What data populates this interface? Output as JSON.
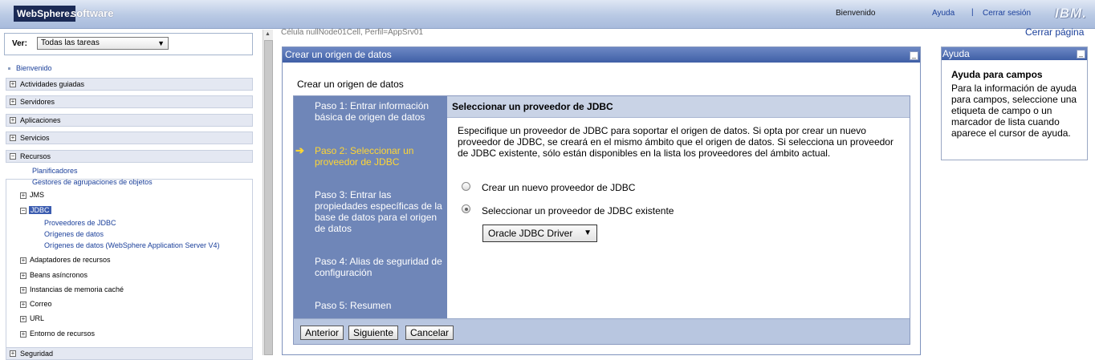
{
  "header": {
    "brand": "WebSphere.",
    "brand_suffix": "software",
    "welcome": "Bienvenido",
    "help": "Ayuda",
    "separator": "|",
    "logout": "Cerrar sesión",
    "vendor_logo": "IBM."
  },
  "sidebar": {
    "view_label": "Ver:",
    "view_value": "Todas las tareas",
    "welcome_link": "Bienvenido",
    "categories": [
      "Actividades guiadas",
      "Servidores",
      "Aplicaciones",
      "Servicios",
      "Recursos",
      "Seguridad"
    ],
    "recursos": {
      "schedulers": "Planificadores",
      "pool_managers": "Gestores de agrupaciones de objetos",
      "jms": "JMS",
      "jdbc": "JDBC",
      "jdbc_providers": "Proveedores de JDBC",
      "data_sources": "Orígenes de datos",
      "data_sources_v4": "Orígenes de datos (WebSphere Application Server V4)",
      "resource_adapters": "Adaptadores de recursos",
      "async_beans": "Beans asíncronos",
      "cache_instances": "Instancias de memoria caché",
      "mail": "Correo",
      "url": "URL",
      "resource_env": "Entorno de recursos"
    }
  },
  "main": {
    "breadcrumb": "Célula nullNode01Cell, Perfil=AppSrv01",
    "close_page": "Cerrar página",
    "panel_title": "Crear un origen de datos",
    "wizard_heading": "Crear un origen de datos",
    "steps": [
      "Paso 1: Entrar información básica de origen de datos",
      "Paso 2: Seleccionar un proveedor de JDBC",
      "Paso 3: Entrar las propiedades específicas de la base de datos para el origen de datos",
      "Paso 4: Alias de seguridad de configuración",
      "Paso 5: Resumen"
    ],
    "active_step": 2,
    "content_title": "Seleccionar un proveedor de JDBC",
    "description": "Especifique un proveedor de JDBC para soportar el origen de datos. Si opta por crear un nuevo proveedor de JDBC, se creará en el mismo ámbito que el origen de datos. Si selecciona un proveedor de JDBC existente, sólo están disponibles en la lista los proveedores del ámbito actual.",
    "radio_new": "Crear un nuevo proveedor de JDBC",
    "radio_existing": "Seleccionar un proveedor de JDBC existente",
    "selected_radio": "existing",
    "driver_value": "Oracle JDBC Driver",
    "buttons": {
      "previous": "Anterior",
      "next": "Siguiente",
      "cancel": "Cancelar"
    }
  },
  "help_panel": {
    "title": "Ayuda",
    "heading": "Ayuda para campos",
    "text": "Para la información de ayuda para campos, seleccione una etiqueta de campo o un marcador de lista cuando aparece el cursor de ayuda."
  },
  "colors": {
    "title_bar": "#3f5fa6",
    "steps_bg": "#6f86b8",
    "active_step": "#ffd633",
    "link": "#1a3f9a"
  },
  "icons": {
    "minimize": "minimize-icon",
    "expand": "plus-box-icon",
    "collapse": "minus-box-icon",
    "step_pointer": "arrow-right-icon"
  }
}
